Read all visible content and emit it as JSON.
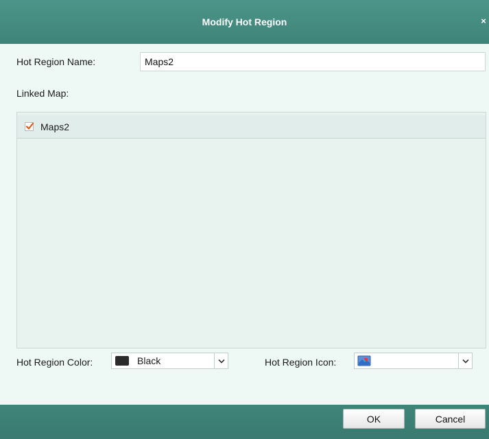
{
  "dialog": {
    "title": "Modify Hot Region",
    "close_glyph": "×"
  },
  "form": {
    "name_label": "Hot Region Name:",
    "name_value": "Maps2",
    "linked_map_label": "Linked Map:",
    "linked_maps": [
      {
        "label": "Maps2",
        "checked": true
      }
    ],
    "color_label": "Hot Region Color:",
    "color_value": "Black",
    "color_swatch": "#2b2b2b",
    "icon_label": "Hot Region Icon:",
    "icon_name": "hot-region-map-icon"
  },
  "buttons": {
    "ok": "OK",
    "cancel": "Cancel"
  },
  "colors": {
    "titlebar": "#3f8479",
    "background": "#eef9f6",
    "checkmark": "#e05a1a"
  }
}
